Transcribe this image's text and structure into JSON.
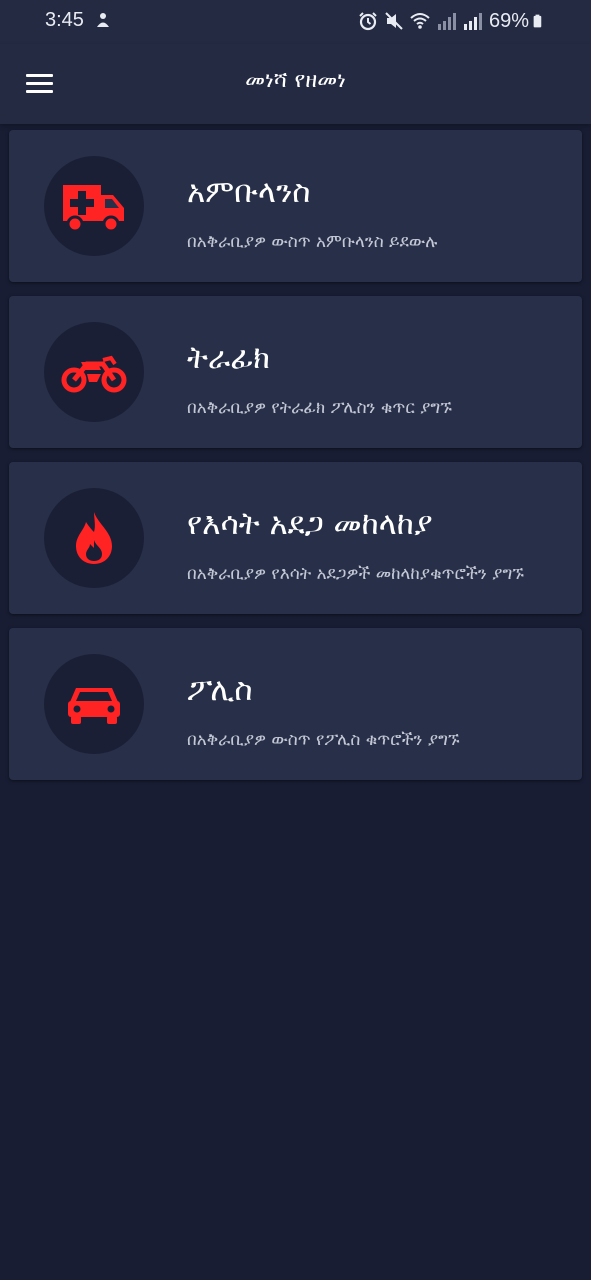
{
  "status_bar": {
    "time": "3:45",
    "battery_percent": "69%",
    "icons": [
      "alarm-icon",
      "mute-icon",
      "wifi-icon",
      "signal-icon",
      "signal-icon",
      "battery-icon"
    ]
  },
  "app_bar": {
    "title": "መነሻ የዘመነ",
    "menu_icon": "hamburger-menu-icon"
  },
  "accent_color": "#ff2323",
  "services": [
    {
      "icon": "ambulance-icon",
      "title": "አምቡላንስ",
      "subtitle": "በአቅራቢያዎ ውስጥ አምቡላንስ ይደውሉ"
    },
    {
      "icon": "motorcycle-icon",
      "title": "ትራፊክ",
      "subtitle": "በአቅራቢያዎ የትራፊክ ፖሊስን ቁጥር ያግኙ"
    },
    {
      "icon": "fire-icon",
      "title": "የእሳት አደጋ መከላከያ",
      "subtitle": "በአቅራቢያዎ የእሳት አደጋዎች መከላከያቁጥሮችን ያግኙ"
    },
    {
      "icon": "police-car-icon",
      "title": "ፖሊስ",
      "subtitle": "በአቅራቢያዎ ውስጥ የፖሊስ ቁጥሮችን ያግኙ"
    }
  ]
}
